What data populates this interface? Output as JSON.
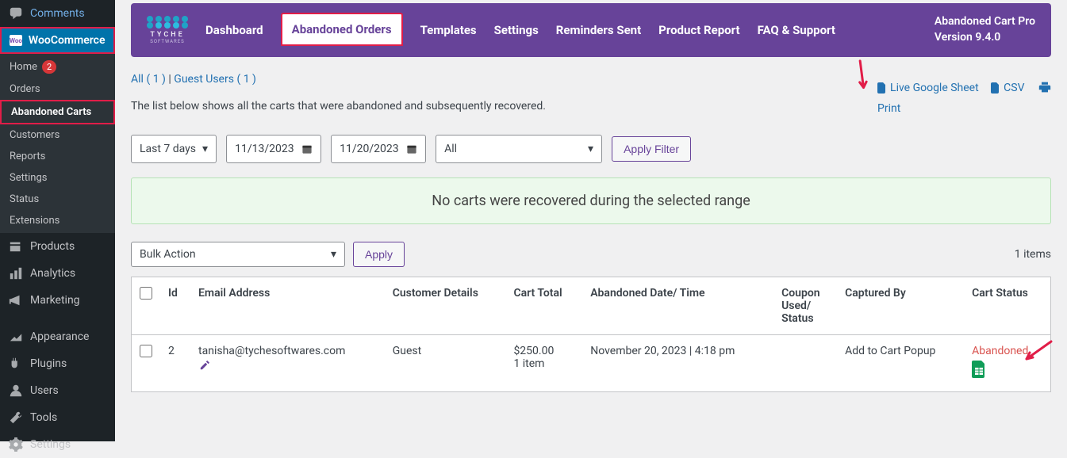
{
  "sidebar": {
    "comments": "Comments",
    "woocommerce": "WooCommerce",
    "sub": {
      "home": "Home",
      "home_count": "2",
      "orders": "Orders",
      "abandoned_carts": "Abandoned Carts",
      "customers": "Customers",
      "reports": "Reports",
      "settings": "Settings",
      "status": "Status",
      "extensions": "Extensions"
    },
    "products": "Products",
    "analytics": "Analytics",
    "marketing": "Marketing",
    "appearance": "Appearance",
    "plugins": "Plugins",
    "users": "Users",
    "tools": "Tools",
    "settings": "Settings"
  },
  "logo": {
    "text": "TYCHE",
    "sub": "SOFTWARES"
  },
  "nav": {
    "dashboard": "Dashboard",
    "abandoned_orders": "Abandoned Orders",
    "templates": "Templates",
    "settings": "Settings",
    "reminders_sent": "Reminders Sent",
    "product_report": "Product Report",
    "faq": "FAQ & Support"
  },
  "version": {
    "line1": "Abandoned Cart Pro",
    "line2": "Version 9.4.0"
  },
  "filters": {
    "all_label": "All",
    "all_count": "( 1 )",
    "sep": " | ",
    "guest_label": "Guest Users",
    "guest_count": "( 1 )"
  },
  "description": "The list below shows all the carts that were abandoned and subsequently recovered.",
  "export": {
    "live_google": "Live Google Sheet",
    "csv": "CSV",
    "print": "Print"
  },
  "controls": {
    "range": "Last 7 days",
    "date_start": "11/13/2023",
    "date_end": "11/20/2023",
    "filter_sel": "All",
    "apply_filter": "Apply Filter"
  },
  "notice": "No carts were recovered during the selected range",
  "bulk": {
    "label": "Bulk Action",
    "apply": "Apply"
  },
  "items_count": "1 items",
  "columns": {
    "id": "Id",
    "email": "Email Address",
    "customer": "Customer Details",
    "total": "Cart Total",
    "date": "Abandoned Date/ Time",
    "coupon": "Coupon Used/ Status",
    "captured": "Captured By",
    "status": "Cart Status"
  },
  "rows": [
    {
      "id": "2",
      "email": "tanisha@tychesoftwares.com",
      "customer": "Guest",
      "total": "$250.00",
      "items": "1 item",
      "date": "November 20, 2023 | 4:18 pm",
      "coupon": "",
      "captured": "Add to Cart Popup",
      "status": "Abandoned"
    }
  ]
}
